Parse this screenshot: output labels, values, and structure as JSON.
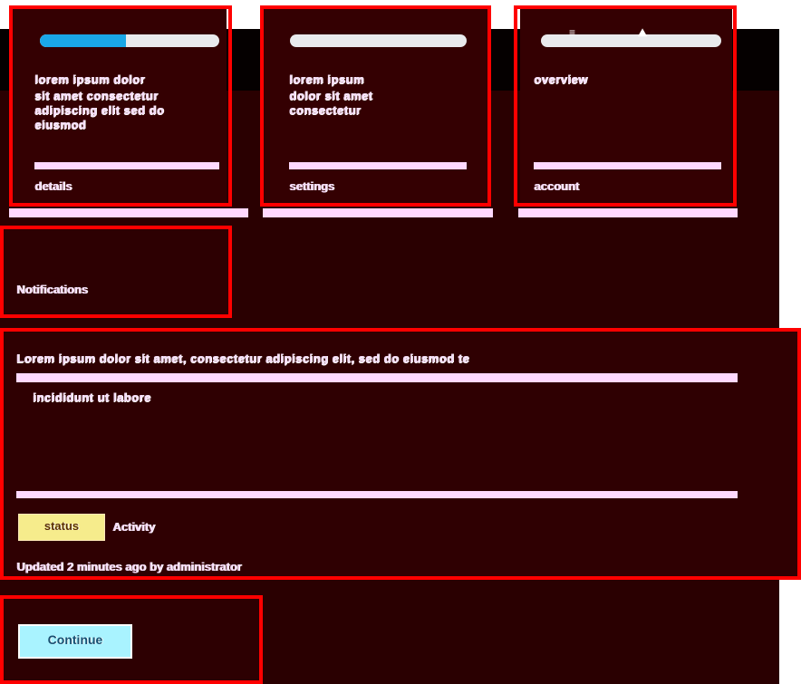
{
  "cards": [
    {
      "name": "card-one",
      "progress": 0.48,
      "title": "lorem ipsum dolor",
      "body": "sit amet consectetur adipiscing elit sed do eiusmod",
      "footer": "details"
    },
    {
      "name": "card-two",
      "progress": 0,
      "title": "lorem ipsum",
      "body": "dolor sit amet consectetur",
      "footer": "settings"
    },
    {
      "name": "card-three",
      "progress": 0,
      "title": "overview",
      "body": "",
      "footer": "account"
    }
  ],
  "section_title": "Notifications",
  "notice": {
    "headline": "Lorem ipsum dolor sit amet, consectetur adipiscing elit, sed do eiusmod tempor",
    "subtext": "incididunt ut labore",
    "badge": "status",
    "label": "Activity",
    "meta": "Updated 2 minutes ago by administrator"
  },
  "action": {
    "label": "Continue"
  },
  "icons": {
    "menu": "menu-icon",
    "mountain": "mountain-icon"
  },
  "colors": {
    "outline": "#ff0000",
    "panel": "#340002",
    "progress": "#1aa7e8",
    "button": "#a9f3ff",
    "badge": "#f6ec8c"
  }
}
